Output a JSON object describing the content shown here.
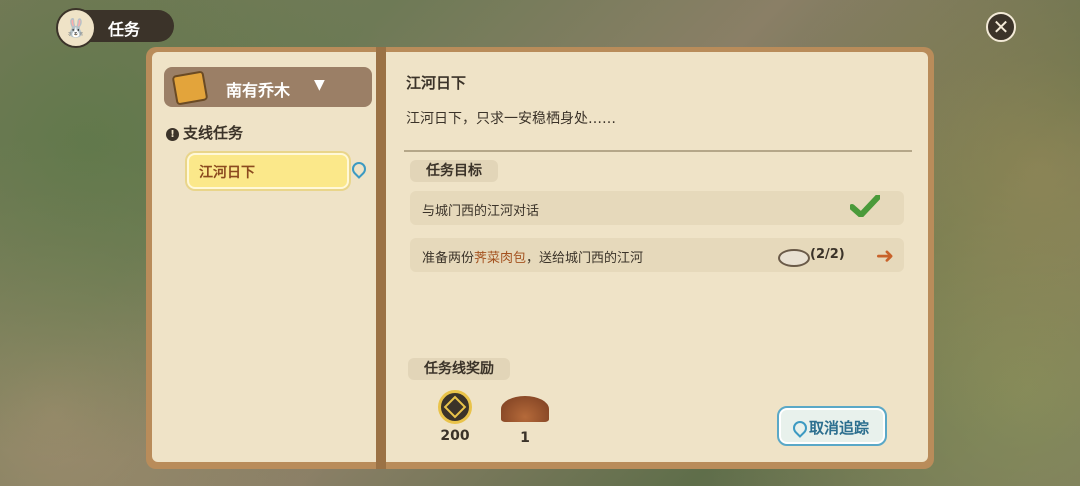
{
  "header": {
    "title": "任务"
  },
  "left": {
    "chapter": "南有乔木",
    "section": "支线任务",
    "quest_item": "江河日下"
  },
  "right": {
    "quest_title": "江河日下",
    "quest_desc": "江河日下，只求一安稳栖身处……",
    "objectives_heading": "任务目标",
    "objectives": [
      {
        "text": "与城门西的江河对话",
        "done": true
      },
      {
        "text_pre": "准备两份",
        "text_highlight": "荠菜肉包",
        "text_post": "，送给城门西的江河",
        "progress": "(2/2)"
      }
    ],
    "rewards_heading": "任务线奖励",
    "rewards": [
      {
        "icon": "coin-icon",
        "amount": "200"
      },
      {
        "icon": "material-icon",
        "amount": "1"
      }
    ],
    "cancel_button": "取消追踪"
  },
  "colors": {
    "highlight": "#a4521f",
    "check": "#4a9a3a",
    "arrow": "#c8622a"
  }
}
